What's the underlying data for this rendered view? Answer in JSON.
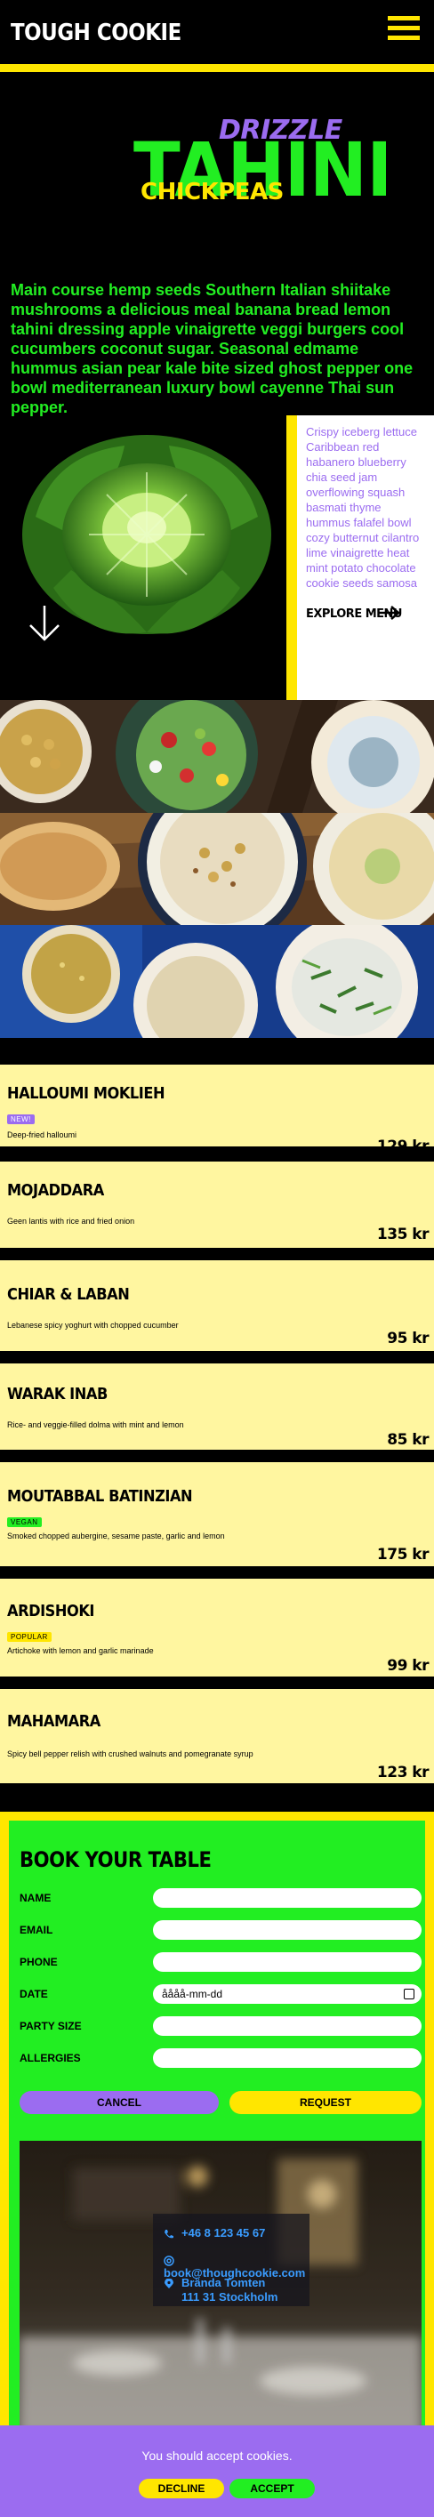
{
  "header": {
    "logo": "TOUGH COOKIE",
    "menu_icon": "hamburger-icon"
  },
  "hero": {
    "word_drizzle": "DRIZZLE",
    "word_tahini": "TAHINI",
    "word_chickpeas": "CHICKPEAS",
    "intro": "Main course hemp seeds Southern Italian shiitake mushrooms a delicious meal banana bread lemon tahini dressing apple vinaigrette veggi burgers cool cucumbers coconut sugar. Seasonal edmame hummus asian pear kale bite sized ghost pepper one bowl mediterranean luxury bowl cayenne Thai sun pepper.",
    "sidebox_text": "Crispy iceberg lettuce Caribbean red habanero blueberry chia seed jam overflowing squash basmati thyme hummus falafel bowl cozy butternut cilantro lime vinaigrette heat mint potato chocolate cookie seeds samosa walnut mushroom tart.",
    "explore_label": "EXPLORE MENU"
  },
  "menu": {
    "items": [
      {
        "name": "HALLOUMI MOKLIEH",
        "badge": "NEW!",
        "desc": "Deep-fried halloumi",
        "price": "129 kr"
      },
      {
        "name": "MOJADDARA",
        "badge": "",
        "desc": "Geen lantis with rice and fried onion",
        "price": "135 kr"
      },
      {
        "name": "CHIAR & LABAN",
        "badge": "",
        "desc": "Lebanese spicy yoghurt with chopped cucumber",
        "price": "95 kr"
      },
      {
        "name": "WARAK INAB",
        "badge": "",
        "desc": "Rice- and veggie-filled dolma with mint and lemon",
        "price": "85 kr"
      },
      {
        "name": "MOUTABBAL BATINZIAN",
        "badge": "VEGAN",
        "desc": "Smoked chopped aubergine, sesame paste, garlic and lemon",
        "price": "175 kr"
      },
      {
        "name": "ARDISHOKI",
        "badge": "POPULAR",
        "desc": "Artichoke with lemon and garlic marinade",
        "price": "99 kr"
      },
      {
        "name": "MAHAMARA",
        "badge": "",
        "desc": "Spicy bell pepper relish with crushed walnuts and pomegranate syrup",
        "price": "123 kr"
      }
    ]
  },
  "booking": {
    "title": "BOOK YOUR TABLE",
    "fields": {
      "name": "NAME",
      "email": "EMAIL",
      "phone": "PHONE",
      "date": "DATE",
      "party": "PARTY SIZE",
      "allergies": "ALLERGIES"
    },
    "date_placeholder": "åååå-mm-dd",
    "cancel_label": "CANCEL",
    "request_label": "REQUEST",
    "contact": {
      "phone": "+46 8 123 45 67",
      "email": "book@thoughcookie.com",
      "address_line1": "Brända Tomten",
      "address_line2": "111 31 Stockholm"
    }
  },
  "cookie": {
    "text": "You should accept cookies.",
    "decline_label": "DECLINE",
    "accept_label": "ACCEPT"
  },
  "colors": {
    "yellow": "#ffe600",
    "green": "#22ee22",
    "purple": "#9b6cf0",
    "cream": "#fff6a0"
  }
}
